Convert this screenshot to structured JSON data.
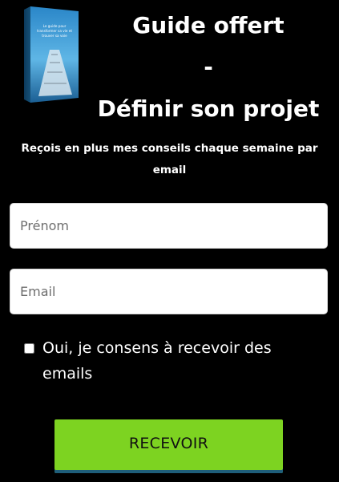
{
  "book": {
    "icon": "ebook-cover-icon",
    "cover_text": "Le guide pour transformer sa vie et trouver sa voie"
  },
  "header": {
    "title_line1": "Guide offert",
    "title_line2": "-",
    "title_line3": "Définir son projet"
  },
  "subtitle": "Reçois en plus mes conseils chaque semaine par email",
  "form": {
    "firstname_placeholder": "Prénom",
    "firstname_value": "",
    "email_placeholder": "Email",
    "email_value": "",
    "consent_checked": false,
    "consent_label": "Oui, je consens à recevoir des emails",
    "submit_label": "RECEVOIR"
  },
  "colors": {
    "background": "#000000",
    "button": "#7dd321",
    "button_shadow": "#1f5e7a",
    "text": "#ffffff"
  }
}
